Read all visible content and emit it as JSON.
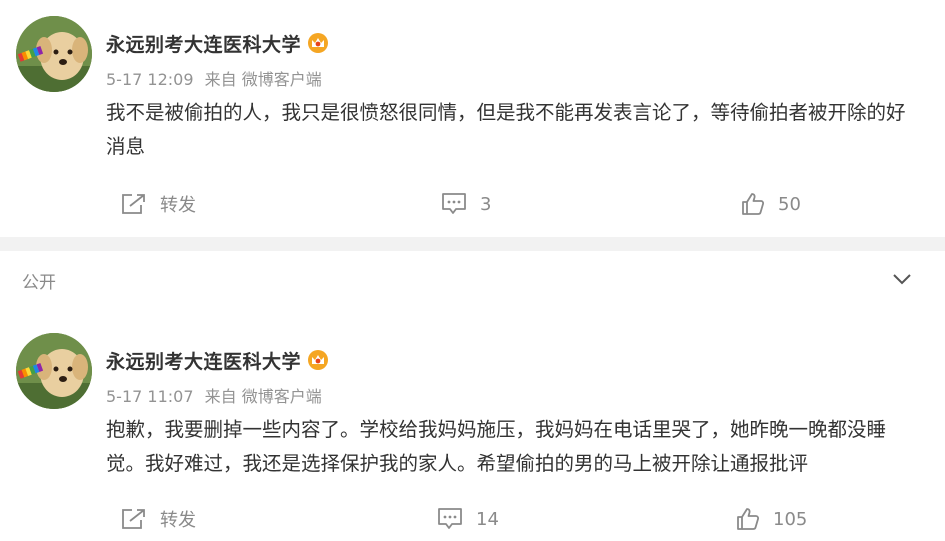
{
  "posts": [
    {
      "username": "永远别考大连医科大学",
      "time": "5-17 12:09",
      "source": "来自 微博客户端",
      "text": "我不是被偷拍的人，我只是很愤怒很同情，但是我不能再发表言论了，等待偷拍者被开除的好消息",
      "repost_label": "转发",
      "comment_count": "3",
      "like_count": "50"
    },
    {
      "username": "永远别考大连医科大学",
      "time": "5-17 11:07",
      "source": "来自 微博客户端",
      "text": "抱歉，我要删掉一些内容了。学校给我妈妈施压，我妈妈在电话里哭了，她昨晚一晚都没睡觉。我好难过，我还是选择保护我的家人。希望偷拍的男的马上被开除让通报批评",
      "repost_label": "转发",
      "comment_count": "14",
      "like_count": "105"
    }
  ],
  "section": {
    "title": "公开"
  },
  "icons": {
    "vip": "crown-badge-icon",
    "repost": "repost-icon",
    "comment": "comment-icon",
    "like": "thumbs-up-icon",
    "collapse": "chevron-down-icon"
  },
  "colors": {
    "text": "#333333",
    "meta": "#939393",
    "action": "#8a8a8a",
    "divider": "#f2f2f2",
    "vip_gold": "#f5a623",
    "vip_red": "#e8431b"
  }
}
